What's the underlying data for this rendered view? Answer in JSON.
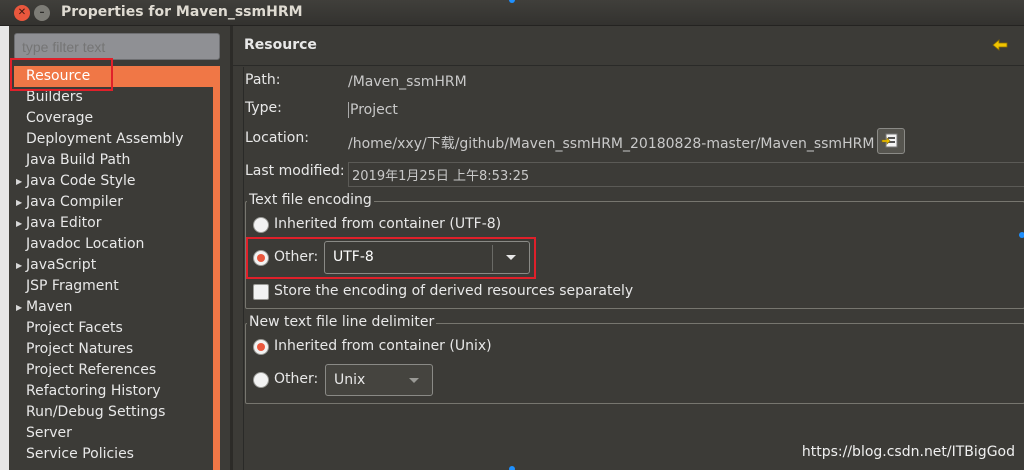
{
  "window": {
    "title": "Properties for Maven_ssmHRM",
    "close_icon": "close-icon",
    "minimize_icon": "minimize-icon"
  },
  "filter": {
    "placeholder": "type filter text"
  },
  "tree": {
    "items": [
      {
        "label": "Resource",
        "expandable": false,
        "selected": true
      },
      {
        "label": "Builders",
        "expandable": false
      },
      {
        "label": "Coverage",
        "expandable": false
      },
      {
        "label": "Deployment Assembly",
        "expandable": false
      },
      {
        "label": "Java Build Path",
        "expandable": false
      },
      {
        "label": "Java Code Style",
        "expandable": true
      },
      {
        "label": "Java Compiler",
        "expandable": true
      },
      {
        "label": "Java Editor",
        "expandable": true
      },
      {
        "label": "Javadoc Location",
        "expandable": false
      },
      {
        "label": "JavaScript",
        "expandable": true
      },
      {
        "label": "JSP Fragment",
        "expandable": false
      },
      {
        "label": "Maven",
        "expandable": true
      },
      {
        "label": "Project Facets",
        "expandable": false
      },
      {
        "label": "Project Natures",
        "expandable": false
      },
      {
        "label": "Project References",
        "expandable": false
      },
      {
        "label": "Refactoring History",
        "expandable": false
      },
      {
        "label": "Run/Debug Settings",
        "expandable": false
      },
      {
        "label": "Server",
        "expandable": false
      },
      {
        "label": "Service Policies",
        "expandable": false
      }
    ],
    "accent_color": "#f07746"
  },
  "page": {
    "title": "Resource",
    "back_icon": "back-arrow-icon",
    "path_label": "Path:",
    "path_value": "/Maven_ssmHRM",
    "type_label": "Type:",
    "type_value": "Project",
    "location_label": "Location:",
    "location_value": "/home/xxy/下载/github/Maven_ssmHRM_20180828-master/Maven_ssmHRM",
    "show_in_system_icon": "open-folder-icon",
    "last_modified_label": "Last modified:",
    "last_modified_value": "2019年1月25日 上午8:53:25"
  },
  "encoding": {
    "group_title": "Text file encoding",
    "inherited_label": "Inherited from container (UTF-8)",
    "other_label": "Other:",
    "other_value": "UTF-8",
    "selected": "other",
    "store_derived_label": "Store the encoding of derived resources separately",
    "store_derived_checked": false
  },
  "delimiter": {
    "group_title": "New text file line delimiter",
    "inherited_label": "Inherited from container (Unix)",
    "other_label": "Other:",
    "other_value": "Unix",
    "selected": "inherited"
  },
  "watermark": "https://blog.csdn.net/ITBigGod",
  "colors": {
    "highlight_box": "#e0202a",
    "radio_selected": "#e9573d"
  }
}
